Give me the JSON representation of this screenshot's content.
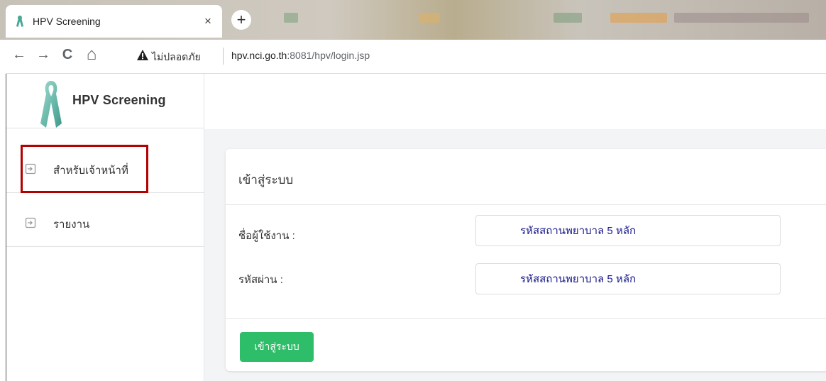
{
  "browser": {
    "tab_title": "HPV Screening",
    "tab_close": "×",
    "new_tab": "+",
    "nav": {
      "back": "←",
      "forward": "→",
      "reload": "C",
      "home": "⌂"
    },
    "security_text": "ไม่ปลอดภัย",
    "url_host": "hpv.nci.go.th",
    "url_rest": ":8081/hpv/login.jsp"
  },
  "sidebar": {
    "brand": "HPV Screening",
    "items": [
      {
        "label": "สำหรับเจ้าหน้าที่",
        "icon": "sign-in-icon"
      },
      {
        "label": "รายงาน",
        "icon": "sign-in-icon"
      }
    ]
  },
  "login_form": {
    "title": "เข้าสู่ระบบ",
    "username_label": "ชื่อผู้ใช้งาน :",
    "username_placeholder": "รหัสสถานพยาบาล 5 หลัก",
    "password_label": "รหัสผ่าน :",
    "password_placeholder": "รหัสสถานพยาบาล 5 หลัก",
    "submit_label": "เข้าสู่ระบบ"
  },
  "colors": {
    "accent_green": "#2ebd68",
    "ribbon_teal": "#6fc3b5",
    "highlight_red": "#b30000",
    "placeholder_navy": "#1a1a8a"
  }
}
